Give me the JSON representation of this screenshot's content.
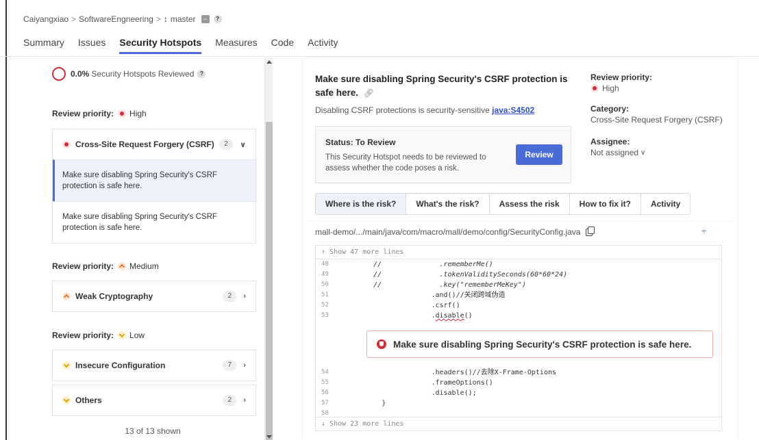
{
  "breadcrumb": {
    "org": "Caiyangxiao",
    "project": "SoftwareEngneering",
    "branch": "master",
    "sep": ">"
  },
  "tabs": [
    {
      "label": "Summary"
    },
    {
      "label": "Issues"
    },
    {
      "label": "Security Hotspots",
      "active": true
    },
    {
      "label": "Measures"
    },
    {
      "label": "Code"
    },
    {
      "label": "Activity"
    }
  ],
  "left": {
    "reviewed_pct": "0.0%",
    "reviewed_text": "Security Hotspots Reviewed",
    "priority_label": "Review priority:",
    "high": {
      "label": "High",
      "category": "Cross-Site Request Forgery (CSRF)",
      "count": "2",
      "items": [
        "Make sure disabling Spring Security's CSRF protection is safe here.",
        "Make sure disabling Spring Security's CSRF protection is safe here."
      ]
    },
    "medium": {
      "label": "Medium",
      "category": "Weak Cryptography",
      "count": "2"
    },
    "low": {
      "label": "Low",
      "categories": [
        {
          "name": "Insecure Configuration",
          "count": "7"
        },
        {
          "name": "Others",
          "count": "2"
        }
      ]
    },
    "shown": "13 of 13 shown"
  },
  "hotspot": {
    "title": "Make sure disabling Spring Security's CSRF protection is safe here.",
    "subtitle": "Disabling CSRF protections is security-sensitive",
    "rule": "java:S4502",
    "review_priority_label": "Review priority:",
    "review_priority": "High",
    "category_label": "Category:",
    "category": "Cross-Site Request Forgery (CSRF)",
    "assignee_label": "Assignee:",
    "assignee": "Not assigned",
    "status": "Status: To Review",
    "status_desc": "This Security Hotspot needs to be reviewed to assess whether the code poses a risk.",
    "review_button": "Review",
    "tabs": [
      {
        "label": "Where is the risk?",
        "active": true
      },
      {
        "label": "What's the risk?"
      },
      {
        "label": "Assess the risk"
      },
      {
        "label": "How to fix it?"
      },
      {
        "label": "Activity"
      }
    ]
  },
  "code": {
    "file": "mall-demo/.../main/java/com/macro/mall/demo/config/SecurityConfig.java",
    "show_top": "Show 47 more lines",
    "show_bottom": "Show 23 more lines",
    "lines_before": [
      {
        "n": "48",
        "t": "        //              .rememberMe()"
      },
      {
        "n": "49",
        "t": "        //              .tokenValiditySeconds(60*60*24)"
      },
      {
        "n": "50",
        "t": "        //              .key(\"rememberMeKey\")"
      },
      {
        "n": "51",
        "t": "                      .and()//关闭跨域伪造"
      },
      {
        "n": "52",
        "t": "                      .csrf()"
      }
    ],
    "issue_line_num": "53",
    "issue_line_prefix": "                      .",
    "issue_line_mark": "disable",
    "issue_line_suffix": "()",
    "issue_message": "Make sure disabling Spring Security's CSRF protection is safe here.",
    "lines_after": [
      {
        "n": "54",
        "t": "                      .headers()//去除X-Frame-Options"
      },
      {
        "n": "55",
        "t": "                      .frameOptions()"
      },
      {
        "n": "56",
        "t": "                      .disable();"
      },
      {
        "n": "57",
        "t": "          }"
      },
      {
        "n": "58",
        "t": ""
      }
    ]
  }
}
